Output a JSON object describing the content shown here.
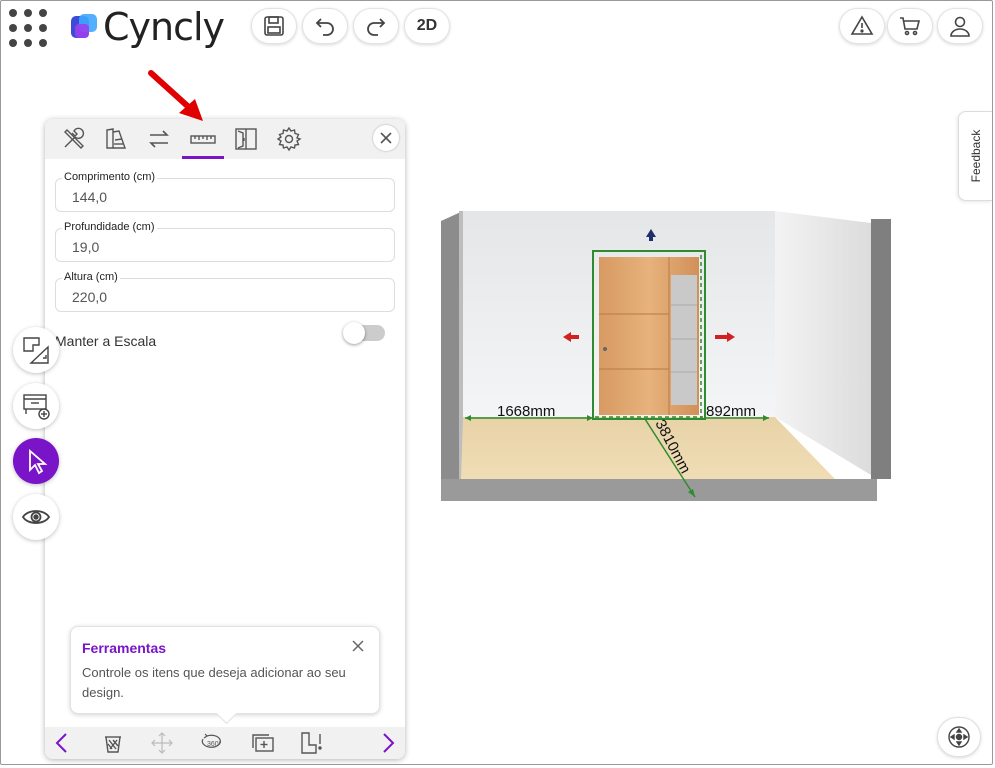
{
  "app": {
    "brand": "Cyncly"
  },
  "header": {
    "apps_icon": "grid-dots-icon",
    "save_icon": "save-icon",
    "undo_icon": "undo-icon",
    "redo_icon": "redo-icon",
    "view_toggle_label": "2D",
    "warning_icon": "warning-icon",
    "cart_icon": "cart-icon",
    "account_icon": "user-icon"
  },
  "feedback": {
    "label": "Feedback"
  },
  "rail": [
    {
      "name": "floorplan-tool",
      "icon": "floorplan-icon",
      "active": false
    },
    {
      "name": "add-furniture",
      "icon": "add-cabinet-icon",
      "active": false
    },
    {
      "name": "select-tool",
      "icon": "cursor-icon",
      "active": true
    },
    {
      "name": "view-options",
      "icon": "eye-icon",
      "active": false
    }
  ],
  "panel": {
    "tabs": [
      {
        "name": "tools",
        "icon": "tools-icon",
        "active": false
      },
      {
        "name": "materials",
        "icon": "swatch-icon",
        "active": false
      },
      {
        "name": "swap",
        "icon": "swap-icon",
        "active": false
      },
      {
        "name": "dimensions",
        "icon": "ruler-icon",
        "active": true
      },
      {
        "name": "doors",
        "icon": "doors-icon",
        "active": false
      },
      {
        "name": "settings",
        "icon": "gear-icon",
        "active": false
      }
    ],
    "fields": {
      "length": {
        "label": "Comprimento (cm)",
        "value": "144,0"
      },
      "depth": {
        "label": "Profundidade (cm)",
        "value": "19,0"
      },
      "height": {
        "label": "Altura (cm)",
        "value": "220,0"
      }
    },
    "keep_scale": {
      "label": "Manter a Escala",
      "on": false
    },
    "tooltip": {
      "title": "Ferramentas",
      "body": "Controle os itens que deseja adicionar ao seu design."
    },
    "bottom_toolbar": [
      {
        "name": "prev",
        "icon": "chevron-left-icon"
      },
      {
        "name": "delete",
        "icon": "trash-icon"
      },
      {
        "name": "move",
        "icon": "move-icon"
      },
      {
        "name": "rotate",
        "icon": "rotate-360-icon",
        "label": "360°"
      },
      {
        "name": "duplicate",
        "icon": "duplicate-icon"
      },
      {
        "name": "alert-item",
        "icon": "item-warning-icon"
      },
      {
        "name": "next",
        "icon": "chevron-right-icon"
      }
    ]
  },
  "scene": {
    "dim_left": "1668mm",
    "dim_right": "892mm",
    "dim_depth": "3810mm",
    "accent": "#2e8b2e"
  },
  "colors": {
    "accent": "#7a14c9",
    "annotation": "#e00000"
  },
  "recenter_icon": "recenter-icon"
}
